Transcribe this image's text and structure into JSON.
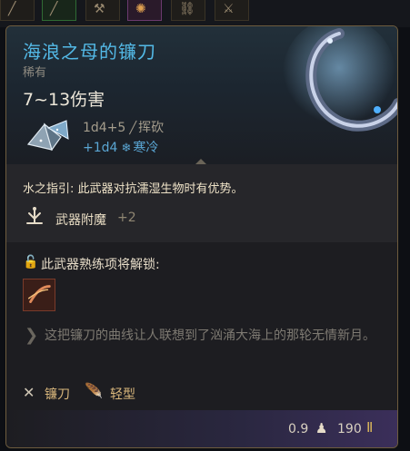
{
  "item": {
    "name": "海浪之母的镰刀",
    "rarity": "稀有",
    "damage": "7~13伤害",
    "primary_damage": "1d4+5",
    "primary_type": "挥砍",
    "secondary_damage": "+1d4",
    "secondary_type": "寒冷",
    "ability": "水之指引: 此武器对抗濡湿生物时有优势。",
    "enchant_label": "武器附魔",
    "enchant_value": "+2",
    "proficiency_label": "此武器熟练项将解锁:",
    "lore": "这把镰刀的曲线让人联想到了汹涌大海上的那轮无情新月。",
    "tags": [
      "镰刀",
      "轻型"
    ],
    "weight": "0.9",
    "price": "190"
  },
  "icons": {
    "slash": "dagger-slash-icon",
    "cold": "snowflake-icon",
    "enchant": "enchant-hand-icon",
    "proficiency": "lock-icon",
    "quote": "quote-icon",
    "sickle_tag": "crossed-sickle-icon",
    "light_tag": "feather-icon",
    "weight": "weight-icon",
    "price": "gold-coin-icon"
  },
  "colors": {
    "name": "#53b9e6",
    "cold_damage": "#5aa6d4",
    "tag_text": "#d9b77c",
    "card_border": "#6e5c3e"
  }
}
